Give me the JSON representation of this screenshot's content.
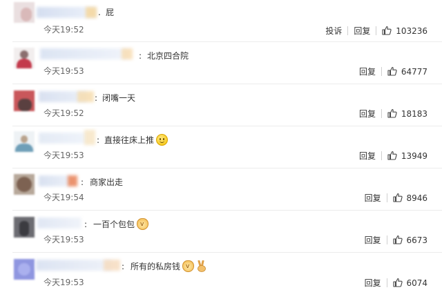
{
  "actions": {
    "report": "投诉",
    "reply": "回复"
  },
  "comments": [
    {
      "text": "屁",
      "emojis": [],
      "time": "今天19:52",
      "likes": "103236",
      "has_report": true
    },
    {
      "text": "北京四合院",
      "emojis": [],
      "time": "今天19:53",
      "likes": "64777",
      "has_report": false
    },
    {
      "text": "闭嘴一天",
      "emojis": [],
      "time": "今天19:52",
      "likes": "18183",
      "has_report": false
    },
    {
      "text": "直接往床上推",
      "emojis": [
        "smile-emoji"
      ],
      "time": "今天19:53",
      "likes": "13949",
      "has_report": false
    },
    {
      "text": "商家出走",
      "emojis": [],
      "time": "今天19:54",
      "likes": "8946",
      "has_report": false
    },
    {
      "text": "一百个包包",
      "emojis": [
        "cat-emoji"
      ],
      "time": "今天19:53",
      "likes": "6673",
      "has_report": false
    },
    {
      "text": "所有的私房钱",
      "emojis": [
        "cat-emoji",
        "victory-hand-emoji"
      ],
      "time": "今天19:53",
      "likes": "6074",
      "has_report": false
    }
  ],
  "colors": {
    "link": "#333333",
    "time": "#666666",
    "divider": "#ececec"
  }
}
